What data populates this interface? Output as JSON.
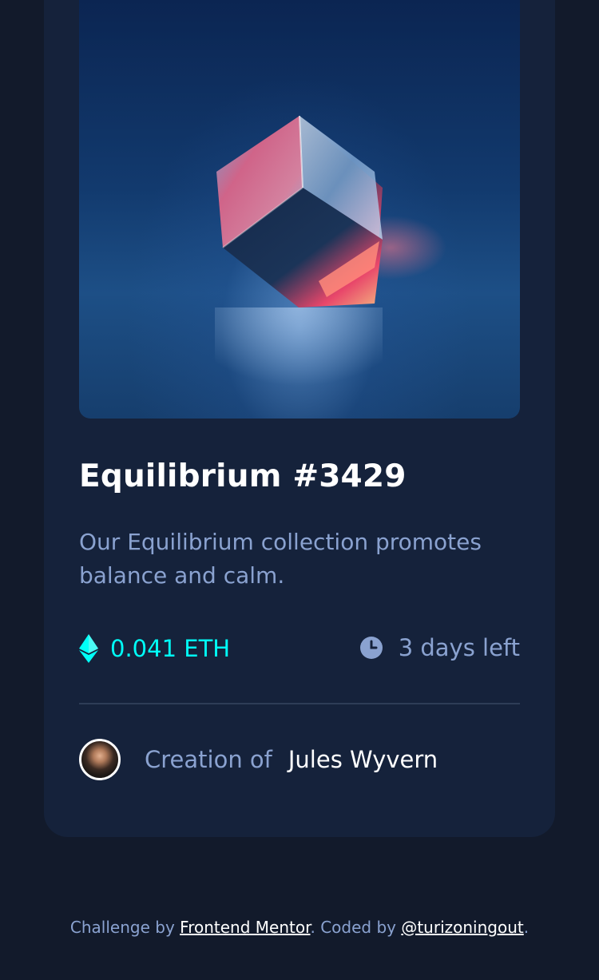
{
  "card": {
    "title": "Equilibrium #3429",
    "description": "Our Equilibrium collection promotes balance and calm.",
    "price": "0.041 ETH",
    "time_left": "3 days left",
    "creation_label": "Creation of",
    "creator_name": "Jules Wyvern"
  },
  "footer": {
    "prefix": "Challenge by ",
    "link1": "Frontend Mentor",
    "middle": ". Coded by ",
    "link2": "@turizoningout",
    "suffix": "."
  },
  "colors": {
    "background": "#121a2b",
    "card": "#15223b",
    "accent_cyan": "#00fff8",
    "muted_blue": "#8aa2d0",
    "white": "#ffffff"
  },
  "icons": {
    "eth": "ethereum-icon",
    "clock": "clock-icon"
  }
}
